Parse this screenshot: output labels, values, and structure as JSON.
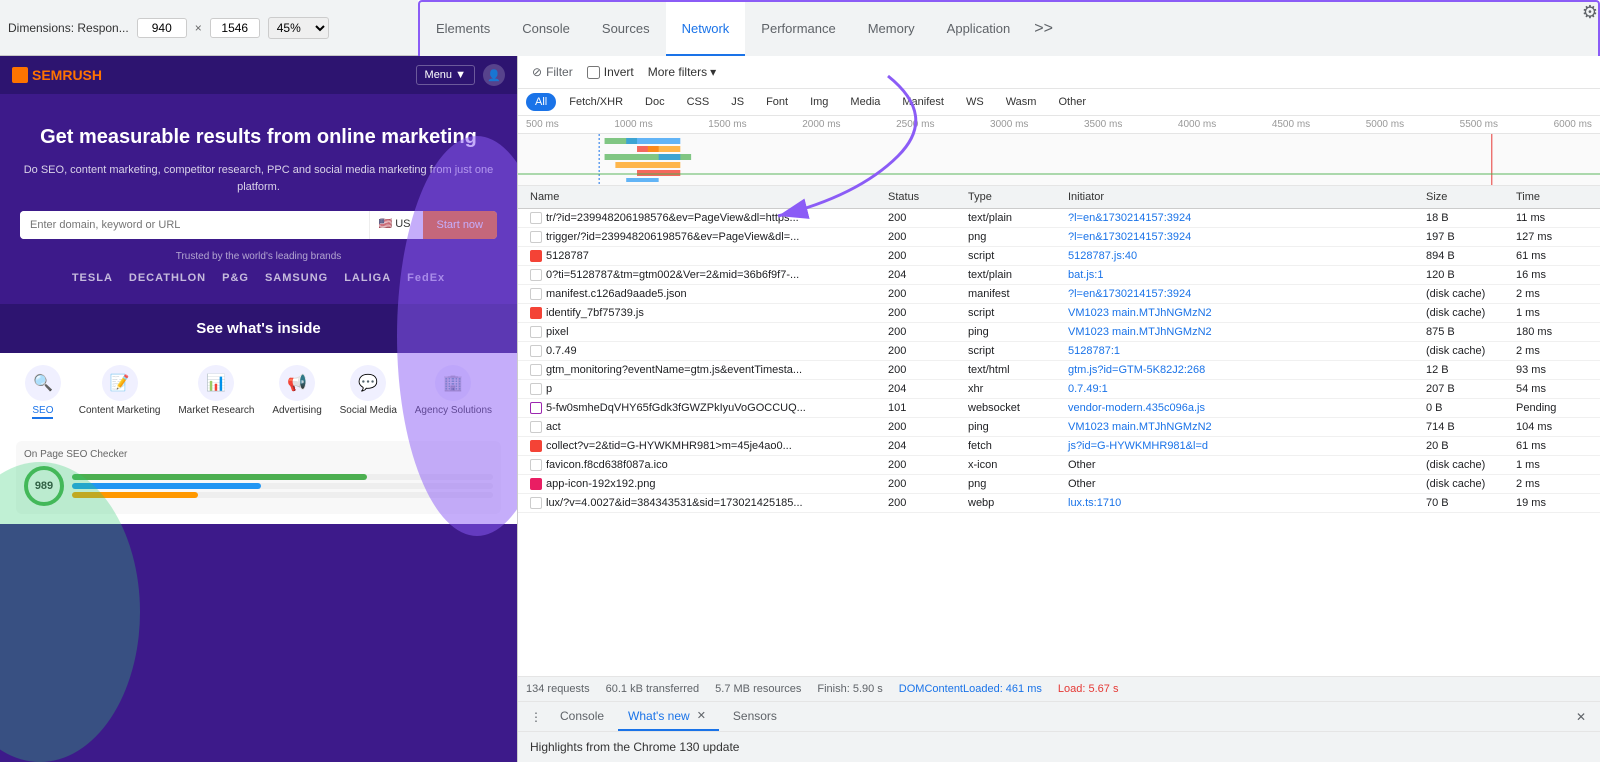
{
  "toolbar": {
    "dimensions_label": "Dimensions: Respon...",
    "width": "940",
    "x": "×",
    "height": "1546",
    "zoom": "45%"
  },
  "devtools": {
    "tabs": [
      {
        "id": "elements",
        "label": "Elements",
        "active": false
      },
      {
        "id": "console",
        "label": "Console",
        "active": false
      },
      {
        "id": "sources",
        "label": "Sources",
        "active": false
      },
      {
        "id": "network",
        "label": "Network",
        "active": true
      },
      {
        "id": "performance",
        "label": "Performance",
        "active": false
      },
      {
        "id": "memory",
        "label": "Memory",
        "active": false
      },
      {
        "id": "application",
        "label": "Application",
        "active": false
      }
    ],
    "more_tabs": ">>"
  },
  "network": {
    "filter_label": "Filter",
    "invert_label": "Invert",
    "more_filters_label": "More filters",
    "chips": [
      "All",
      "Fetch/XHR",
      "Doc",
      "CSS",
      "JS",
      "Font",
      "Img",
      "Media",
      "Manifest",
      "WS",
      "Wasm",
      "Other"
    ],
    "active_chip": "All",
    "timeline_marks": [
      "500 ms",
      "1000 ms",
      "1500 ms",
      "2000 ms",
      "2500 ms",
      "3000 ms",
      "3500 ms",
      "4000 ms",
      "4500 ms",
      "5000 ms",
      "5500 ms",
      "6000 ms"
    ],
    "table": {
      "headers": [
        "Name",
        "Status",
        "Type",
        "Initiator",
        "Size",
        "Time"
      ],
      "rows": [
        {
          "name": "tr/?id=239948206198576&ev=PageView&dl=https...",
          "icon": "plain",
          "status": "200",
          "type": "text/plain",
          "initiator": "?l=en&1730214157:3924",
          "size": "18 B",
          "time": "11 ms"
        },
        {
          "name": "trigger/?id=239948206198576&ev=PageView&dl=...",
          "icon": "plain",
          "status": "200",
          "type": "png",
          "initiator": "?l=en&1730214157:3924",
          "size": "197 B",
          "time": "127 ms"
        },
        {
          "name": "5128787",
          "icon": "red",
          "status": "200",
          "type": "script",
          "initiator": "5128787.js:40",
          "size": "894 B",
          "time": "61 ms"
        },
        {
          "name": "0?ti=5128787&tm=gtm002&Ver=2&mid=36b6f9f7-...",
          "icon": "plain",
          "status": "204",
          "type": "text/plain",
          "initiator": "bat.js:1",
          "size": "120 B",
          "time": "16 ms"
        },
        {
          "name": "manifest.c126ad9aade5.json",
          "icon": "plain",
          "status": "200",
          "type": "manifest",
          "initiator": "?l=en&1730214157:3924",
          "size": "(disk cache)",
          "time": "2 ms"
        },
        {
          "name": "identify_7bf75739.js",
          "icon": "red",
          "status": "200",
          "type": "script",
          "initiator": "VM1023 main.MTJhNGMzN2",
          "size": "(disk cache)",
          "time": "1 ms"
        },
        {
          "name": "pixel",
          "icon": "plain",
          "status": "200",
          "type": "ping",
          "initiator": "VM1023 main.MTJhNGMzN2",
          "size": "875 B",
          "time": "180 ms"
        },
        {
          "name": "0.7.49",
          "icon": "plain",
          "status": "200",
          "type": "script",
          "initiator": "5128787:1",
          "size": "(disk cache)",
          "time": "2 ms"
        },
        {
          "name": "gtm_monitoring?eventName=gtm.js&eventTimesta...",
          "icon": "plain",
          "status": "200",
          "type": "text/html",
          "initiator": "gtm.js?id=GTM-5K82J2:268",
          "size": "12 B",
          "time": "93 ms"
        },
        {
          "name": "p",
          "icon": "plain",
          "status": "204",
          "type": "xhr",
          "initiator": "0.7.49:1",
          "size": "207 B",
          "time": "54 ms"
        },
        {
          "name": "5-fw0smheDqVHY65fGdk3fGWZPkIyuVoGOCCUQ...",
          "icon": "ws",
          "status": "101",
          "type": "websocket",
          "initiator": "vendor-modern.435c096a.js",
          "size": "0 B",
          "time": "Pending"
        },
        {
          "name": "act",
          "icon": "plain",
          "status": "200",
          "type": "ping",
          "initiator": "VM1023 main.MTJhNGMzN2",
          "size": "714 B",
          "time": "104 ms"
        },
        {
          "name": "collect?v=2&tid=G-HYWKMHR981&gtm=45je4ao0...",
          "icon": "red",
          "status": "204",
          "type": "fetch",
          "initiator": "js?id=G-HYWKMHR981&l=d",
          "size": "20 B",
          "time": "61 ms"
        },
        {
          "name": "favicon.f8cd638f087a.ico",
          "icon": "plain",
          "status": "200",
          "type": "x-icon",
          "initiator": "Other",
          "size": "(disk cache)",
          "time": "1 ms"
        },
        {
          "name": "app-icon-192x192.png",
          "icon": "red",
          "status": "200",
          "type": "png",
          "initiator": "Other",
          "size": "(disk cache)",
          "time": "2 ms"
        },
        {
          "name": "lux/?v=4.0027&id=384343531&sid=173021425185...",
          "icon": "plain",
          "status": "200",
          "type": "webp",
          "initiator": "lux.ts:1710",
          "size": "70 B",
          "time": "19 ms"
        }
      ]
    },
    "status_bar": {
      "requests": "134 requests",
      "transferred": "60.1 kB transferred",
      "resources": "5.7 MB resources",
      "finish": "Finish: 5.90 s",
      "dom_loaded": "DOMContentLoaded: 461 ms",
      "load": "Load: 5.67 s"
    }
  },
  "bottom_panel": {
    "tabs": [
      {
        "id": "console",
        "label": "Console",
        "active": false,
        "closeable": false
      },
      {
        "id": "whats-new",
        "label": "What's new",
        "active": true,
        "closeable": true
      },
      {
        "id": "sensors",
        "label": "Sensors",
        "active": false,
        "closeable": false
      }
    ],
    "content": "Highlights from the Chrome 130 update"
  },
  "website": {
    "logo": "SEMRUSH",
    "menu": "Menu ▼",
    "hero_title": "Get measurable results from online marketing",
    "hero_subtitle": "Do SEO, content marketing, competitor research, PPC and social media marketing from just one platform.",
    "search_placeholder": "Enter domain, keyword or URL",
    "country": "🇺🇸 US",
    "cta": "Start now",
    "trusted_text": "Trusted by the world's leading brands",
    "brands": [
      "TESLA",
      "DECATHLON",
      "P&G",
      "SAMSUNG",
      "LALIGA",
      "FedEx"
    ],
    "see_inside": "See what's inside",
    "icons": [
      {
        "label": "SEO",
        "active": true
      },
      {
        "label": "Content Marketing",
        "active": false
      },
      {
        "label": "Market Research",
        "active": false
      },
      {
        "label": "Advertising",
        "active": false
      },
      {
        "label": "Social Media",
        "active": false
      },
      {
        "label": "Agency Solutions",
        "active": false
      }
    ]
  }
}
